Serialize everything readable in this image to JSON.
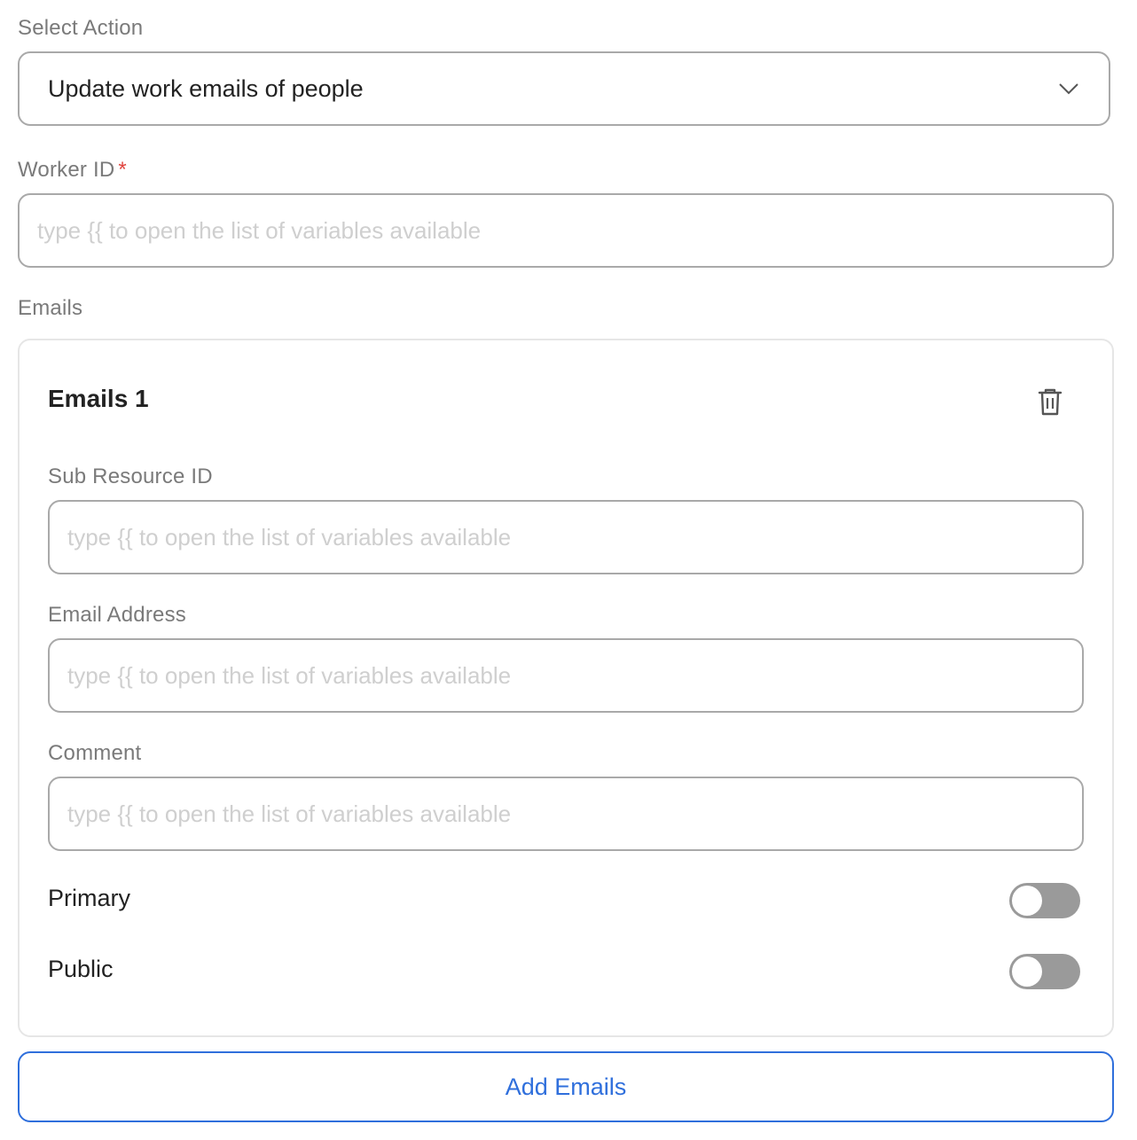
{
  "action": {
    "label": "Select Action",
    "value": "Update work emails of people"
  },
  "worker_id": {
    "label": "Worker ID",
    "required_mark": "*",
    "placeholder": "type {{ to open the list of variables available",
    "value": ""
  },
  "emails": {
    "section_label": "Emails",
    "items": [
      {
        "title": "Emails 1",
        "sub_resource_id": {
          "label": "Sub Resource ID",
          "placeholder": "type {{ to open the list of variables available"
        },
        "email_address": {
          "label": "Email Address",
          "placeholder": "type {{ to open the list of variables available"
        },
        "comment": {
          "label": "Comment",
          "placeholder": "type {{ to open the list of variables available"
        },
        "primary": {
          "label": "Primary",
          "on": false
        },
        "public": {
          "label": "Public",
          "on": false
        }
      }
    ],
    "add_button_label": "Add Emails"
  },
  "colors": {
    "accent": "#2f6fdc",
    "required": "#e0443e",
    "toggle_off": "#9a9a9a",
    "border": "#a9a9a9"
  }
}
